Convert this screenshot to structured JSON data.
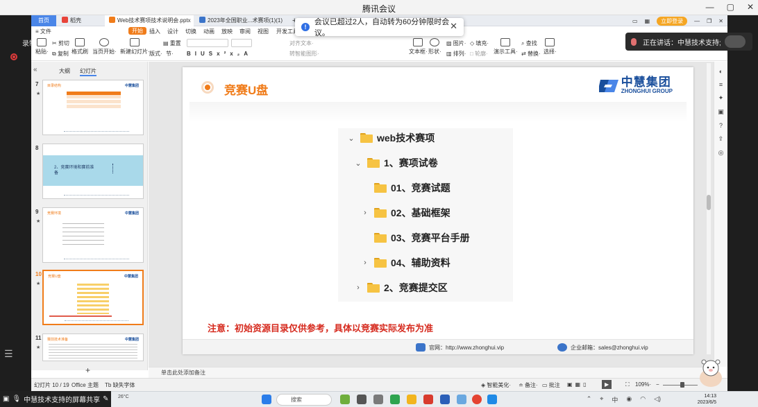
{
  "meeting": {
    "title": "腾讯会议",
    "recording_label": "录制中",
    "toast_text": "会议已超过2人，自动转为60分钟限时会议。",
    "speaking_text": "正在讲话：中慧技术支持;",
    "share_text": "中慧技术支持的屏幕共享"
  },
  "wps": {
    "tabs": {
      "home": "首页",
      "wps": "稻壳",
      "ppt": "Web技术赛项技术说明会.pptx",
      "pdf": "2023年全国职业...术赛项(1)(1)"
    },
    "login": "立即登录",
    "menus": [
      "≡ 文件",
      "开始",
      "插入",
      "设计",
      "切换",
      "动画",
      "放映",
      "审阅",
      "视图",
      "开发工具"
    ],
    "toolbar": {
      "paste": "粘贴·",
      "cut": "剪切",
      "copy": "复制",
      "format_painter": "格式刷",
      "play_from_current": "当页开始·",
      "new_slide": "新建幻灯片·",
      "layout": "版式·",
      "section": "节·",
      "reset": "重置",
      "align_text": "对齐文本·",
      "convert_to_smartart": "转智能图形·",
      "textbox": "文本框·",
      "shape": "形状·",
      "picture": "图片·",
      "arrange": "排列·",
      "fill": "填充·",
      "outline": "轮廓·",
      "find": "查找",
      "replace": "替换·",
      "presentation_tools": "演示工具·",
      "select": "选择·"
    },
    "panel": {
      "outline_tab": "大纲",
      "slides_tab": "幻灯片"
    },
    "thumbs": [
      {
        "num": "7",
        "title": "目录结构"
      },
      {
        "num": "8",
        "title": "2、竞赛环境和赛前准备"
      },
      {
        "num": "9",
        "title": "竞赛环境"
      },
      {
        "num": "10",
        "title": "竞赛U盘"
      },
      {
        "num": "11",
        "title": "赛前技术准备"
      }
    ],
    "slide": {
      "title": "竞赛U盘",
      "logo_cn": "中慧集团",
      "logo_en": "ZHONGHUI GROUP",
      "tree": [
        {
          "chev": "⌄",
          "label": "web技术赛项"
        },
        {
          "chev": "⌄",
          "label": "1、赛项试卷"
        },
        {
          "chev": "",
          "label": "01、竞赛试题"
        },
        {
          "chev": "›",
          "label": "02、基础框架"
        },
        {
          "chev": "",
          "label": "03、竞赛平台手册"
        },
        {
          "chev": "›",
          "label": "04、辅助资料"
        },
        {
          "chev": "›",
          "label": "2、竞赛提交区"
        }
      ],
      "note": "注意：初始资源目录仅供参考，具体以竞赛实际发布为准",
      "website": "官网：http://www.zhonghui.vip",
      "email": "企业邮箱：sales@zhonghui.vip"
    },
    "notes_placeholder": "单击此处添加备注",
    "status": {
      "slide_index": "幻灯片 10 / 19",
      "theme": "Office 主题",
      "missing_font": "缺失字体",
      "smart_beautify": "智能美化·",
      "notes": "备注·",
      "comments": "批注",
      "zoom": "109%·"
    }
  },
  "taskbar": {
    "search": "搜索",
    "weather": "26°C",
    "time": "14:13",
    "date": "2023/6/5",
    "ime": "中"
  },
  "colors": {
    "accent_orange": "#f07c1a",
    "brand_blue": "#1a4f9c",
    "note_red": "#d62b1f",
    "tab_blue": "#4a86e8"
  }
}
